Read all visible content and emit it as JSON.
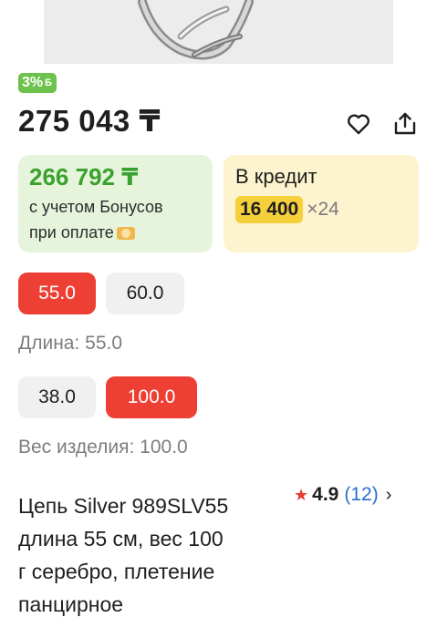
{
  "product": {
    "bonus_badge": {
      "percent": "3%",
      "symbol": "Б"
    },
    "price": "275 043 ₸",
    "actions": {
      "favorite_icon": "heart-icon",
      "share_icon": "share-icon"
    },
    "bonus_card": {
      "price": "266 792 ₸",
      "note_line1": "с учетом Бонусов",
      "note_line2": "при оплате",
      "icon": "bonus-coin-icon"
    },
    "credit_card": {
      "title": "В кредит",
      "amount": "16 400",
      "term": "×24"
    },
    "length_options": [
      {
        "label": "55.0",
        "selected": true
      },
      {
        "label": "60.0",
        "selected": false
      }
    ],
    "length_label": "Длина: 55.0",
    "weight_options": [
      {
        "label": "38.0",
        "selected": false
      },
      {
        "label": "100.0",
        "selected": true
      }
    ],
    "weight_label": "Вес изделия: 100.0",
    "title_lines": [
      "Цепь Silver 989SLV55",
      "длина 55 см, вес 100",
      "г серебро, плетение",
      "панцирное"
    ],
    "rating": {
      "score": "4.9",
      "count": "(12)"
    }
  },
  "colors": {
    "accent_red": "#ee3f34",
    "bonus_green": "#3aa12e",
    "credit_yellow": "#f5d03b",
    "link_blue": "#2a6fd1"
  }
}
